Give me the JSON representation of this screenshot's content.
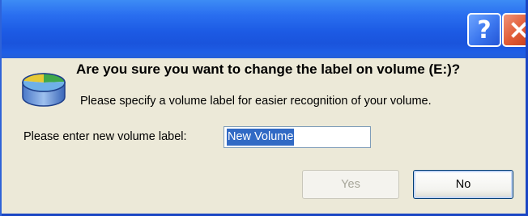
{
  "titlebar": {
    "help_glyph": "?",
    "close_glyph": "×"
  },
  "dialog": {
    "question": "Are you sure you want to change the label on volume (E:)?",
    "subtext": "Please specify a volume label for easier recognition of your volume.",
    "field_label": "Please enter new volume label:",
    "field_value": "New Volume",
    "yes_label": "Yes",
    "no_label": "No",
    "yes_enabled": false
  },
  "icons": {
    "app": "disk-volume-icon",
    "help": "help-icon",
    "close": "close-icon"
  },
  "colors": {
    "titlebar": "#1c5ae4",
    "close_button": "#e15c36",
    "help_button": "#3b76ee",
    "dialog_bg": "#ece9d8",
    "selection": "#316ac5"
  }
}
